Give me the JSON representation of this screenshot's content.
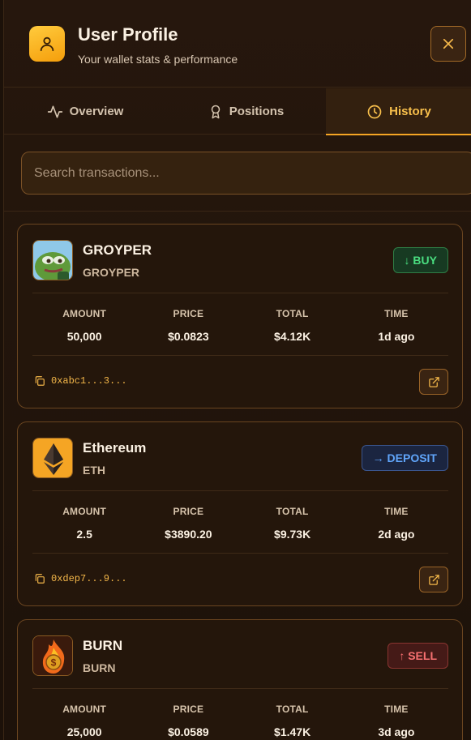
{
  "header": {
    "title": "User Profile",
    "subtitle": "Your wallet stats & performance",
    "icon": "user-icon",
    "close_icon": "close-icon"
  },
  "tabs": [
    {
      "label": "Overview",
      "icon": "activity-icon",
      "active": false
    },
    {
      "label": "Positions",
      "icon": "award-icon",
      "active": false
    },
    {
      "label": "History",
      "icon": "clock-icon",
      "active": true
    }
  ],
  "search": {
    "placeholder": "Search transactions...",
    "value": ""
  },
  "stat_labels": {
    "amount": "AMOUNT",
    "price": "PRICE",
    "total": "TOTAL",
    "time": "TIME"
  },
  "transactions": [
    {
      "name": "GROYPER",
      "symbol": "GROYPER",
      "type": "↓ BUY",
      "amount": "50,000",
      "price": "$0.0823",
      "total": "$4.12K",
      "time": "1d ago",
      "hash": "0xabc1...3...",
      "icon": "groyper-frog-icon"
    },
    {
      "name": "Ethereum",
      "symbol": "ETH",
      "type": "→ DEPOSIT",
      "amount": "2.5",
      "price": "$3890.20",
      "total": "$9.73K",
      "time": "2d ago",
      "hash": "0xdep7...9...",
      "icon": "ethereum-icon"
    },
    {
      "name": "BURN",
      "symbol": "BURN",
      "type": "↑ SELL",
      "amount": "25,000",
      "price": "$0.0589",
      "total": "$1.47K",
      "time": "3d ago",
      "hash": "",
      "icon": "burn-coin-icon"
    }
  ],
  "colors": {
    "accent": "#f5a524",
    "buy": "#4ade80",
    "deposit": "#60a5fa",
    "sell": "#f87171",
    "background": "#1c1109"
  }
}
